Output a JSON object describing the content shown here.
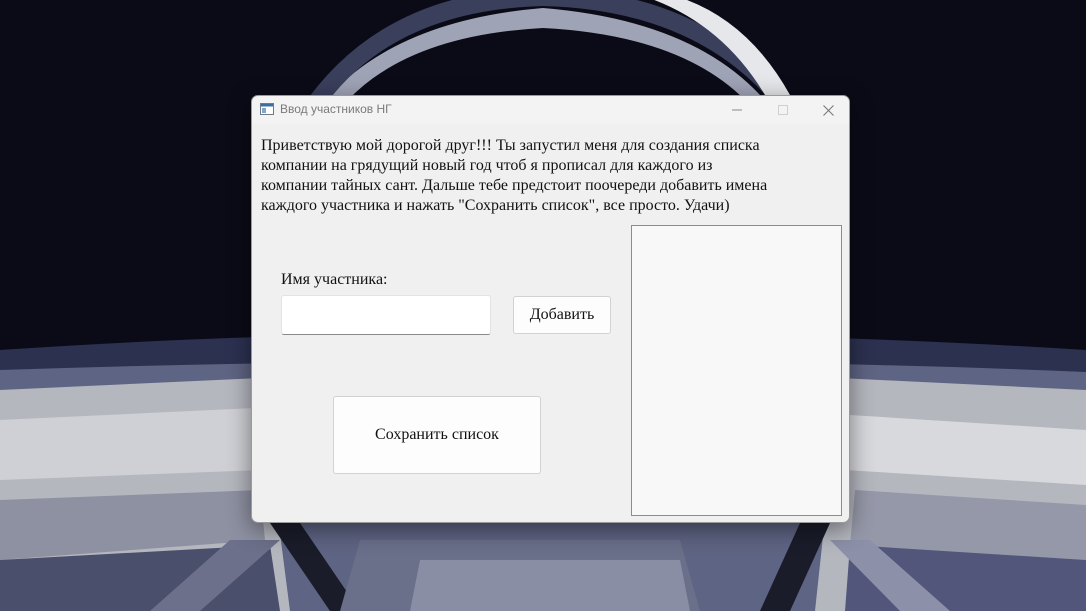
{
  "window": {
    "title": "Ввод участников НГ",
    "buttons": {
      "minimize_icon": "minimize-icon",
      "maximize_icon": "maximize-icon",
      "close_icon": "close-icon"
    }
  },
  "main": {
    "greeting_lines": [
      "Приветствую мой дорогой друг!!! Ты запустил меня для создания списка",
      "компании на грядущий новый год чтоб я прописал для каждого из",
      "компании тайных сант. Дальше тебе предстоит поочереди добавить имена",
      "каждого участника и нажать \"Сохранить список\", все просто. Удачи)"
    ],
    "name_label": "Имя участника:",
    "name_input": {
      "value": "",
      "placeholder": ""
    },
    "add_button_label": "Добавить",
    "save_button_label": "Сохранить список",
    "participants": []
  },
  "colors": {
    "window_bg": "#f0f0f0",
    "list_bg": "#f8f8f8",
    "wallpaper_dark": "#0b0b18"
  }
}
